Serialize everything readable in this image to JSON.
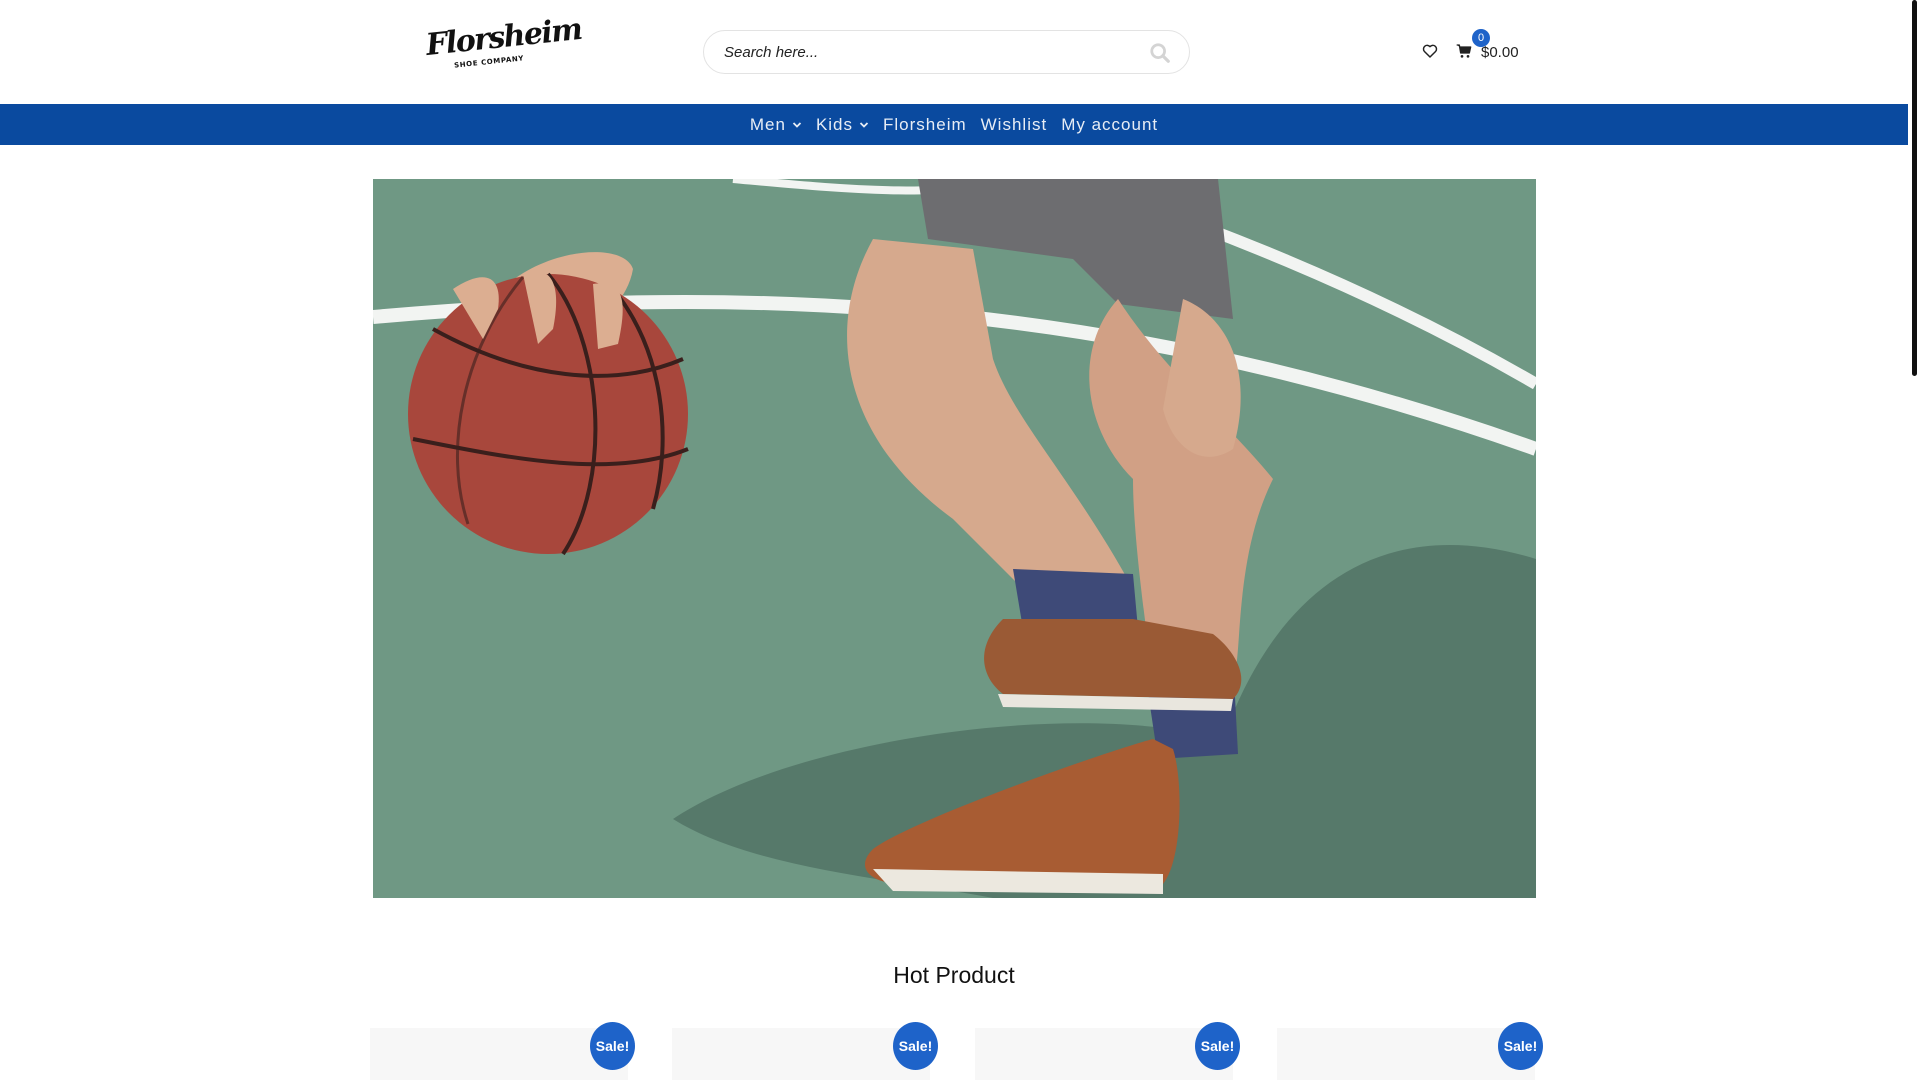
{
  "header": {
    "logo": {
      "script": "Florsheim",
      "subtitle": "SHOE COMPANY"
    },
    "search": {
      "placeholder": "Search here...",
      "icon": "search-icon"
    },
    "wishlist_icon": "heart-icon",
    "cart": {
      "icon": "cart-icon",
      "count": "0",
      "total": "$0.00"
    }
  },
  "nav": {
    "items": [
      {
        "label": "Men",
        "has_dropdown": true
      },
      {
        "label": "Kids",
        "has_dropdown": true
      },
      {
        "label": "Florsheim",
        "has_dropdown": false
      },
      {
        "label": "Wishlist",
        "has_dropdown": false
      },
      {
        "label": "My account",
        "has_dropdown": false
      }
    ]
  },
  "hot_product": {
    "title": "Hot Product",
    "products": [
      {
        "badge": "Sale!"
      },
      {
        "badge": "Sale!"
      },
      {
        "badge": "Sale!"
      },
      {
        "badge": "Sale!"
      }
    ]
  },
  "colors": {
    "nav_bg": "#0a4a9f",
    "accent": "#1e63c9",
    "court_green": "#6f9884"
  }
}
